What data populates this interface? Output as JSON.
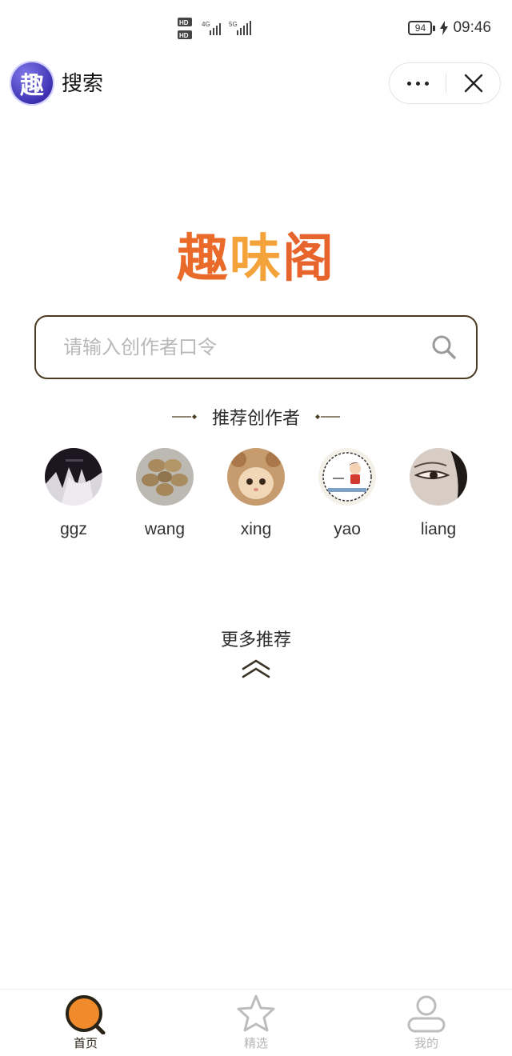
{
  "status_bar": {
    "network_label_1": "HD",
    "network_label_2": "HD",
    "network_gen_1": "4G",
    "network_gen_2": "5G",
    "battery": "94",
    "time": "09:46"
  },
  "title_bar": {
    "logo_char": "趣",
    "title": "搜索"
  },
  "brand": {
    "chars": [
      "趣",
      "味",
      "阁"
    ]
  },
  "search": {
    "placeholder": "请输入创作者口令",
    "value": ""
  },
  "recommend": {
    "title": "推荐创作者",
    "creators": [
      {
        "name": "ggz",
        "avatar": "anime-dark-hair"
      },
      {
        "name": "wang",
        "avatar": "nuts-on-plate"
      },
      {
        "name": "xing",
        "avatar": "kitten-in-bear-hat"
      },
      {
        "name": "yao",
        "avatar": "cartoon-boy-badge"
      },
      {
        "name": "liang",
        "avatar": "eye-closeup"
      }
    ]
  },
  "more": {
    "label": "更多推荐"
  },
  "tab_bar": {
    "tabs": [
      {
        "label": "首页",
        "icon": "search-home-icon",
        "active": true
      },
      {
        "label": "精选",
        "icon": "star-icon",
        "active": false
      },
      {
        "label": "我的",
        "icon": "user-icon",
        "active": false
      }
    ],
    "active_color": "#2a2418",
    "inactive_color": "#b5b5b5",
    "accent": "#f08a2a"
  },
  "colors": {
    "search_border": "#4a3b22",
    "brand_orange": "#ea6a2a",
    "brand_yellow": "#f4a23a"
  }
}
